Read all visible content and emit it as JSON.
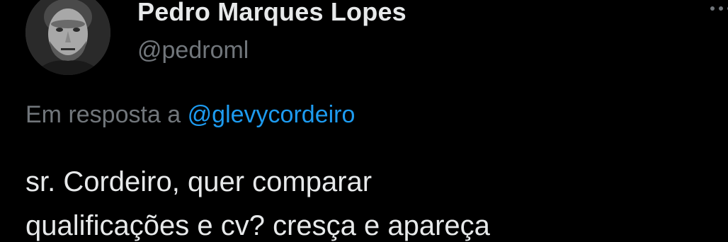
{
  "author": {
    "display_name": "Pedro Marques Lopes",
    "handle": "@pedroml",
    "avatar_icon": "user-avatar-photo"
  },
  "reply_context": {
    "prefix": "Em resposta a",
    "mention": "@glevycordeiro"
  },
  "tweet": {
    "text_line_1": "sr. Cordeiro, quer comparar",
    "text_line_2": "qualificações e cv? cresça e apareça"
  },
  "colors": {
    "background": "#000000",
    "primary_text": "#e7e9ea",
    "secondary_text": "#71767b",
    "link": "#1d9bf0"
  },
  "icons": {
    "more": "more-options-icon"
  }
}
